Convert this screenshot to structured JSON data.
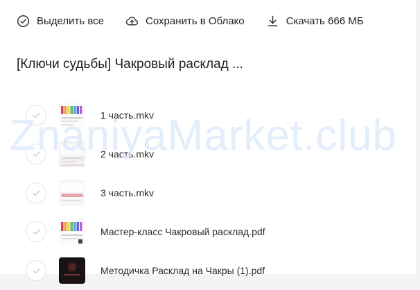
{
  "toolbar": {
    "select_all_label": "Выделить все",
    "save_cloud_label": "Сохранить в Облако",
    "download_label": "Скачать 666 МБ"
  },
  "folder": {
    "title": "[Ключи судьбы] Чакровый расклад ..."
  },
  "watermark": "ZnaniyaMarket.club",
  "files": [
    {
      "name": "1 часть.mkv",
      "thumb": "chakra-cards"
    },
    {
      "name": "2 часть.mkv",
      "thumb": "light-doc"
    },
    {
      "name": "3 часть.mkv",
      "thumb": "pink-stripe"
    },
    {
      "name": "Мастер-класс Чакровый расклад.pdf",
      "thumb": "chakra-cards"
    },
    {
      "name": "Методичка  Расклад на Чакры (1).pdf",
      "thumb": "dark-cover"
    }
  ],
  "colors": {
    "text": "#1f1f1f",
    "watermark": "#dbe7fb",
    "check_border": "#e3e3e3"
  }
}
